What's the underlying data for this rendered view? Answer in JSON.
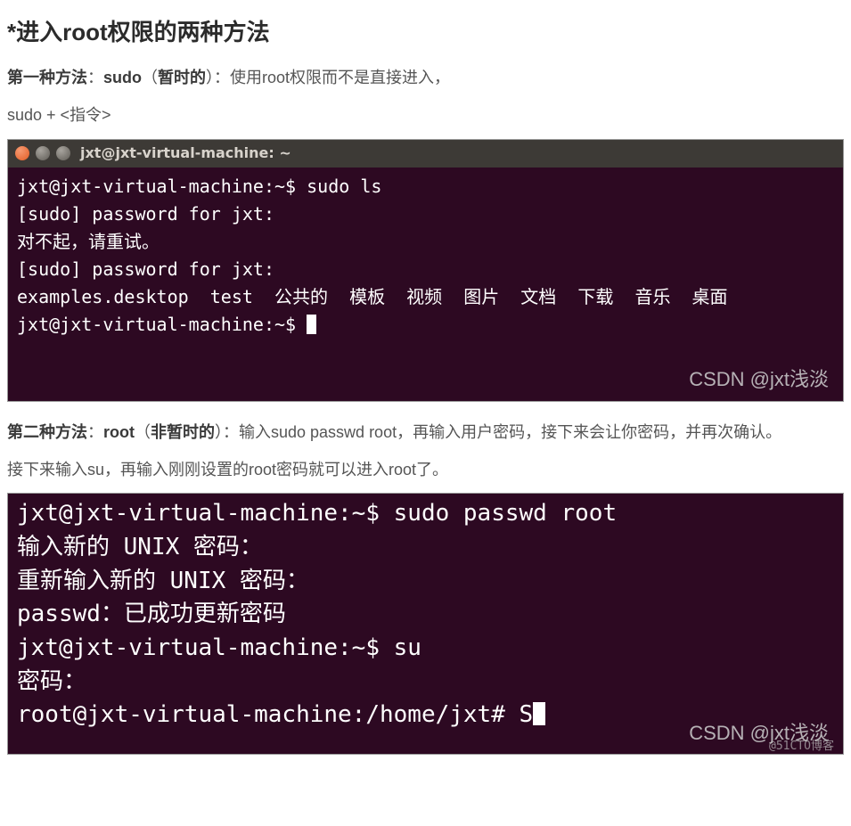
{
  "title": "*进入root权限的两种方法",
  "p1": {
    "label": "第一种方法",
    "tool": "sudo",
    "note": "暂时的",
    "desc": "使用root权限而不是直接进入，"
  },
  "p2": "sudo + <指令>",
  "term1": {
    "titlebar": "jxt@jxt-virtual-machine: ~",
    "lines": [
      "jxt@jxt-virtual-machine:~$ sudo ls",
      "[sudo] password for jxt:",
      "对不起，请重试。",
      "[sudo] password for jxt:",
      "examples.desktop  test  公共的  模板  视频  图片  文档  下载  音乐  桌面",
      "jxt@jxt-virtual-machine:~$ "
    ],
    "watermark": "CSDN @jxt浅淡"
  },
  "p3": {
    "label": "第二种方法",
    "tool": "root",
    "note": "非暂时的",
    "desc": "输入sudo passwd root，再输入用户密码，接下来会让你密码，并再次确认。"
  },
  "p4": "接下来输入su，再输入刚刚设置的root密码就可以进入root了。",
  "term2": {
    "lines": [
      "jxt@jxt-virtual-machine:~$ sudo passwd root",
      "输入新的 UNIX 密码：",
      "重新输入新的 UNIX 密码：",
      "passwd：已成功更新密码",
      "jxt@jxt-virtual-machine:~$ su",
      "密码：",
      "root@jxt-virtual-machine:/home/jxt# S"
    ],
    "watermark": "CSDN @jxt浅淡",
    "watermark2": "@51CTO博客"
  }
}
